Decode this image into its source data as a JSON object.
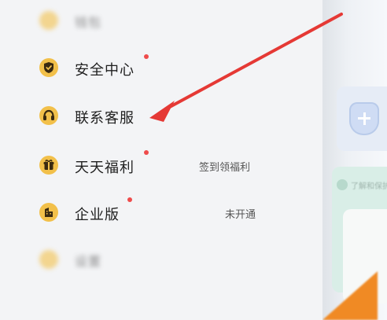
{
  "menu": {
    "items": [
      {
        "label": "钱包",
        "blurred": true
      },
      {
        "label": "安全中心",
        "red_dot": true
      },
      {
        "label": "联系客服"
      },
      {
        "label": "天天福利",
        "red_dot": true,
        "subtitle": "签到领福利"
      },
      {
        "label": "企业版",
        "red_dot": true,
        "subtitle": "未开通"
      },
      {
        "label": "设置",
        "blurred": true
      }
    ]
  },
  "right_panel": {
    "hint_text": "了解和保护"
  },
  "colors": {
    "accent_icon": "#f2c04a",
    "dot": "#ef4b4b",
    "arrow": "#e53935"
  }
}
